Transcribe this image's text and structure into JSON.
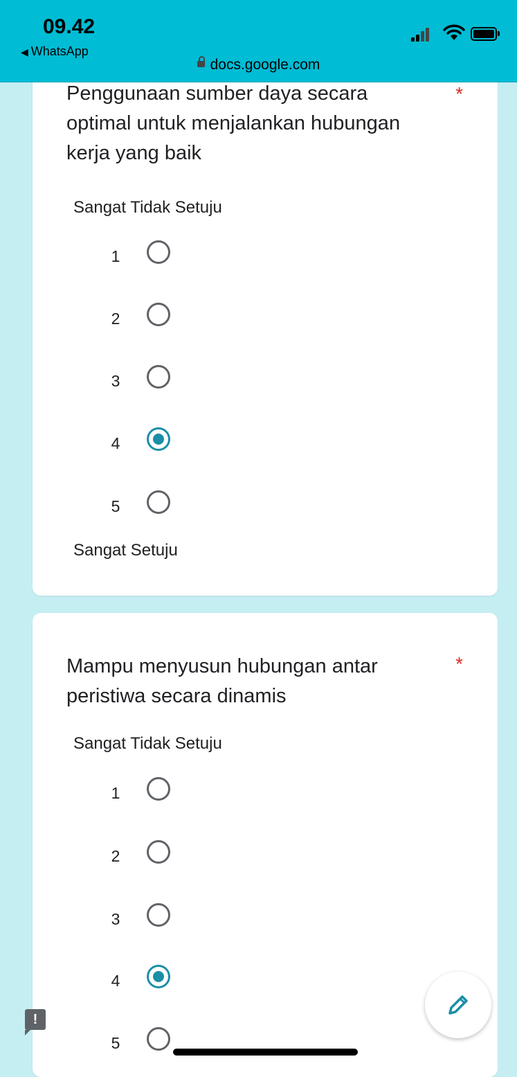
{
  "status_bar": {
    "time": "09.42",
    "back_app": "WhatsApp",
    "url": "docs.google.com"
  },
  "questions": [
    {
      "title": "Penggunaan sumber daya secara optimal untuk menjalankan hubungan kerja yang baik",
      "required": "*",
      "low_label": "Sangat Tidak Setuju",
      "high_label": "Sangat Setuju",
      "options": [
        "1",
        "2",
        "3",
        "4",
        "5"
      ],
      "selected": "4"
    },
    {
      "title": "Mampu menyusun hubungan antar peristiwa secara dinamis",
      "required": "*",
      "low_label": "Sangat Tidak Setuju",
      "options": [
        "1",
        "2",
        "3",
        "4",
        "5"
      ],
      "selected": "4"
    }
  ],
  "feedback_glyph": "!",
  "colors": {
    "status_bar": "#00bcd4",
    "background": "#c5eef3",
    "accent": "#1a8fa6",
    "required": "#d93025"
  },
  "icons": [
    "back-arrow-icon",
    "lock-icon",
    "signal-icon",
    "wifi-icon",
    "battery-icon",
    "edit-pencil-icon",
    "feedback-icon"
  ]
}
